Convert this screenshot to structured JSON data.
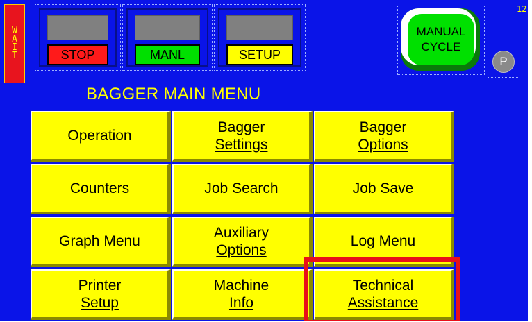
{
  "wait": [
    "W",
    "A",
    "I",
    "T"
  ],
  "status": {
    "stop": "STOP",
    "manl": "MANL",
    "setup": "SETUP"
  },
  "cycle": {
    "line1": "MANUAL",
    "line2": "CYCLE"
  },
  "p_button": "P",
  "corner_number": "12",
  "title": "BAGGER MAIN MENU",
  "menu": [
    [
      "Operation"
    ],
    [
      "Bagger",
      "Settings"
    ],
    [
      "Bagger",
      "Options"
    ],
    [
      "Counters"
    ],
    [
      "Job Search"
    ],
    [
      "Job Save"
    ],
    [
      "Graph Menu"
    ],
    [
      "Auxiliary",
      "Options"
    ],
    [
      "Log Menu"
    ],
    [
      "Printer",
      "Setup"
    ],
    [
      "Machine",
      "Info"
    ],
    [
      "Technical",
      "Assistance"
    ]
  ],
  "highlighted_item": "Technical Assistance",
  "colors": {
    "background": "#0a14e8",
    "button": "#ffff00",
    "highlight": "#e8101a",
    "stop": "#ff1a1a",
    "manl": "#00e000",
    "cycle": "#00e000"
  }
}
